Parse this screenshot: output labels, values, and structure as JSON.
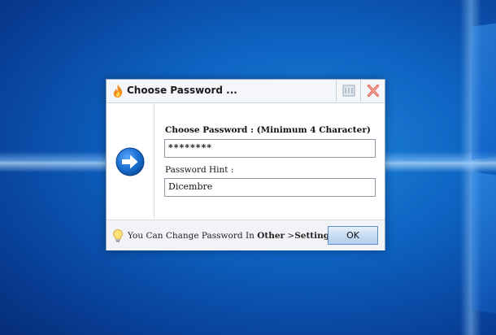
{
  "dialog": {
    "title": "Choose Password ...",
    "password_label": "Choose Password : (Minimum 4 Character)",
    "password_value": "********",
    "hint_label": "Password Hint :",
    "hint_value": "Dicembre",
    "footer_prefix": "You Can Change Password In ",
    "footer_link1": "Other",
    "footer_sep": " >",
    "footer_link2": "Settings.",
    "ok_label": "OK"
  },
  "icons": {
    "title": "flame-icon",
    "settings": "settings-icon",
    "close": "close-icon",
    "arrow": "arrow-right-icon",
    "tip": "lightbulb-icon"
  },
  "colors": {
    "accent_blue": "#1a6fd0",
    "close_red": "#e46c5e",
    "desktop_blue": "#0e63c2"
  }
}
